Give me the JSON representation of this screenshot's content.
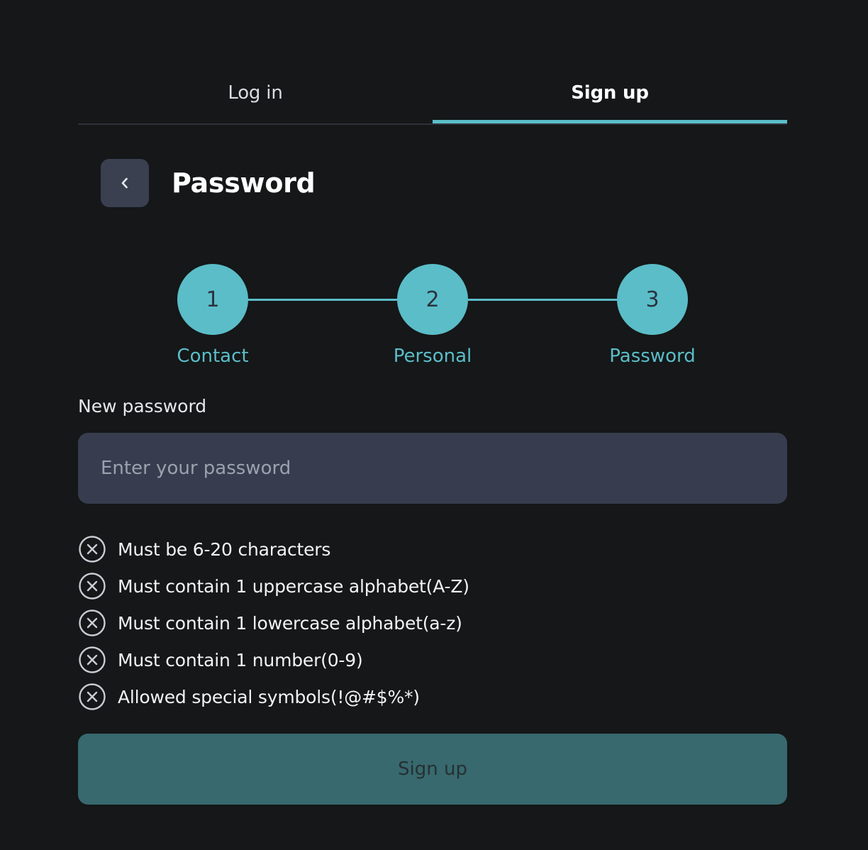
{
  "tabs": [
    {
      "label": "Log in",
      "active": false
    },
    {
      "label": "Sign up",
      "active": true
    }
  ],
  "header": {
    "title": "Password",
    "back_icon": "chevron-left-icon"
  },
  "stepper": {
    "steps": [
      {
        "number": "1",
        "label": "Contact"
      },
      {
        "number": "2",
        "label": "Personal"
      },
      {
        "number": "3",
        "label": "Password"
      }
    ]
  },
  "form": {
    "field_label": "New password",
    "placeholder": "Enter your password",
    "value": ""
  },
  "rules": [
    {
      "text": "Must be 6-20 characters",
      "icon": "x-circle-icon"
    },
    {
      "text": "Must contain 1 uppercase alphabet(A-Z)",
      "icon": "x-circle-icon"
    },
    {
      "text": "Must contain 1 lowercase alphabet(a-z)",
      "icon": "x-circle-icon"
    },
    {
      "text": "Must contain 1 number(0-9)",
      "icon": "x-circle-icon"
    },
    {
      "text": "Allowed special symbols(!@#$%*)",
      "icon": "x-circle-icon"
    }
  ],
  "submit": {
    "label": "Sign up"
  },
  "colors": {
    "background": "#151718",
    "accent": "#5bbdc8",
    "input_bg": "#373d4e",
    "button_disabled": "#37696e"
  }
}
